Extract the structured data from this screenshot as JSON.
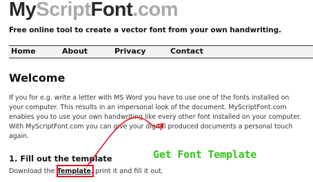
{
  "header": {
    "logo": {
      "my": "My",
      "script": "Script",
      "font": "Font",
      "com": ".com",
      "colors": {
        "dark": "#2a2a2a",
        "light": "#a9a9a9"
      }
    },
    "tagline": "Free online tool to create a vector font from your own handwriting."
  },
  "nav": {
    "items": [
      {
        "label": "Home"
      },
      {
        "label": "About"
      },
      {
        "label": "Privacy"
      },
      {
        "label": "Contact"
      }
    ]
  },
  "main": {
    "heading": "Welcome",
    "intro_lines": [
      "If you for e.g. write a letter with MS Word you have to use one of the fonts installed on",
      "your computer. This results in an impersonal look of the document. MyScriptFont.com",
      "enables you to use your own handwriting like every other font installed on your computer.",
      "With MyScriptFont.com you can give your digital produced documents a personal touch",
      "again."
    ],
    "step1": {
      "heading": "1. Fill out the template",
      "text_before": "Download the ",
      "link": "Template",
      "text_after": ", print it and fill it out."
    }
  },
  "annotation": {
    "label": "Get Font Template",
    "label_color": "#2ec414",
    "arrow_color": "#e8101a",
    "icon": "curved-arrow-icon"
  }
}
